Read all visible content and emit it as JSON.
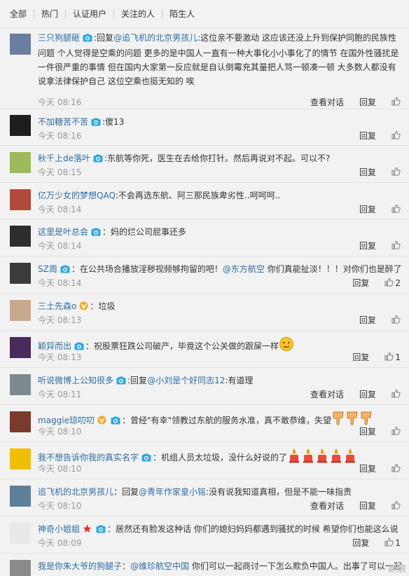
{
  "tabs": [
    "全部",
    "热门",
    "认证用户",
    "关注的人",
    "陌生人"
  ],
  "actions": {
    "view_dialog": "查看对话",
    "reply": "回复"
  },
  "comments": [
    {
      "user": "三只狗腿砸",
      "badges": [
        "camera"
      ],
      "parts": [
        {
          "t": ":回复"
        },
        {
          "t": "@追飞机的北京男孩儿",
          "m": 1
        },
        {
          "t": ":这位亲不要激动 这应该还没上升到保护同胞的民族性问题 个人觉得是空乘的问题 更多的是中国人一直有一种大事化小小事化了的情节 在国外性骚扰是一件很严重的事情 但在国内大家第一反应就是自认倒霉充其量把人骂一顿凑一顿 大多数人都没有说拿法律保护自己 这位空乘也挺无知的 唉"
        }
      ],
      "time": "今天 08:16",
      "dialog": true,
      "likes": ""
    },
    {
      "user": "不加糖苦不苦",
      "badges": [
        "camera"
      ],
      "parts": [
        {
          "t": ":傻13"
        }
      ],
      "time": "今天 08:16",
      "dialog": false,
      "likes": ""
    },
    {
      "user": "秋千上de落叶",
      "badges": [
        "camera"
      ],
      "parts": [
        {
          "t": ":东航等你死，医生在去给你打针。然后再说对不起。可以不?"
        }
      ],
      "time": "今天 08:15",
      "dialog": false,
      "likes": ""
    },
    {
      "user": "亿万少女的梦想QAQ",
      "badges": [],
      "parts": [
        {
          "t": ":不会再选东航、阿三那民族卑劣性..呵呵呵.."
        }
      ],
      "time": "今天 08:14",
      "dialog": false,
      "likes": ""
    },
    {
      "user": "这里是叶总会",
      "badges": [
        "camera"
      ],
      "parts": [
        {
          "t": "：妈的烂公司屁事还多"
        }
      ],
      "time": "今天 08:14",
      "dialog": false,
      "likes": ""
    },
    {
      "user": "SZ周",
      "badges": [
        "camera"
      ],
      "parts": [
        {
          "t": "：在公共场合播放淫秽视频够拘留的吧！"
        },
        {
          "t": "@东方航空",
          "m": 1
        },
        {
          "t": " 你们真能扯淡！！！对你们也是醉了"
        }
      ],
      "time": "今天 08:14",
      "dialog": false,
      "likes": "2"
    },
    {
      "user": "三土先森o",
      "badges": [
        "vip"
      ],
      "parts": [
        {
          "t": "：垃圾"
        }
      ],
      "time": "今天 08:13",
      "dialog": false,
      "likes": ""
    },
    {
      "user": "颖异而出",
      "badges": [
        "camera"
      ],
      "parts": [
        {
          "t": "：祝股票狂跌公司破产，毕竟这个公关做的跟屎一样"
        }
      ],
      "emoji": "face",
      "emoji_n": 1,
      "time": "今天 08:13",
      "dialog": false,
      "likes": "1"
    },
    {
      "user": "听说微博上公知很多",
      "badges": [
        "camera"
      ],
      "parts": [
        {
          "t": ":回复"
        },
        {
          "t": "@小刘是个好同志12",
          "m": 1
        },
        {
          "t": ":有道理"
        }
      ],
      "time": "今天 08:11",
      "dialog": true,
      "likes": ""
    },
    {
      "user": "maggie琼叨叨",
      "badges": [
        "vip",
        "camera"
      ],
      "parts": [
        {
          "t": "：曾经\"有幸\"领教过东航的服务水准，真不敢恭维，失望"
        }
      ],
      "emoji": "thumb",
      "emoji_n": 3,
      "time": "今天 08:10",
      "dialog": false,
      "likes": ""
    },
    {
      "user": "我不想告诉你我的真实名字",
      "badges": [
        "camera"
      ],
      "parts": [
        {
          "t": "：机组人员太垃圾，没什么好说的了"
        }
      ],
      "emoji": "candle",
      "emoji_n": 5,
      "time": "今天 08:10",
      "dialog": false,
      "likes": ""
    },
    {
      "user": "追飞机的北京男孩儿",
      "badges": [],
      "parts": [
        {
          "t": "：回复"
        },
        {
          "t": "@青年作家皇小铭",
          "m": 1
        },
        {
          "t": ":没有说我知道真相，但是不能一味指责"
        }
      ],
      "time": "今天 08:10",
      "dialog": true,
      "likes": ""
    },
    {
      "user": "神奇小姐姐",
      "badges": [
        "star",
        "camera"
      ],
      "parts": [
        {
          "t": "：居然还有脸发这种话 你们的媳妇妈妈都遇到骚扰的时候 希望你们也能这么说"
        }
      ],
      "time": "今天 08:09",
      "dialog": false,
      "likes": "1"
    },
    {
      "user": "我是你朱大爷的狗腿子",
      "badges": [],
      "parts": [
        {
          "t": "："
        },
        {
          "t": "@维珍航空中国",
          "m": 1
        },
        {
          "t": " 你们可以一起商讨一下怎么欺负中国人。出事了可以一起"
        }
      ],
      "time": "",
      "dialog": false,
      "likes": ""
    }
  ],
  "watermark": "新浪"
}
